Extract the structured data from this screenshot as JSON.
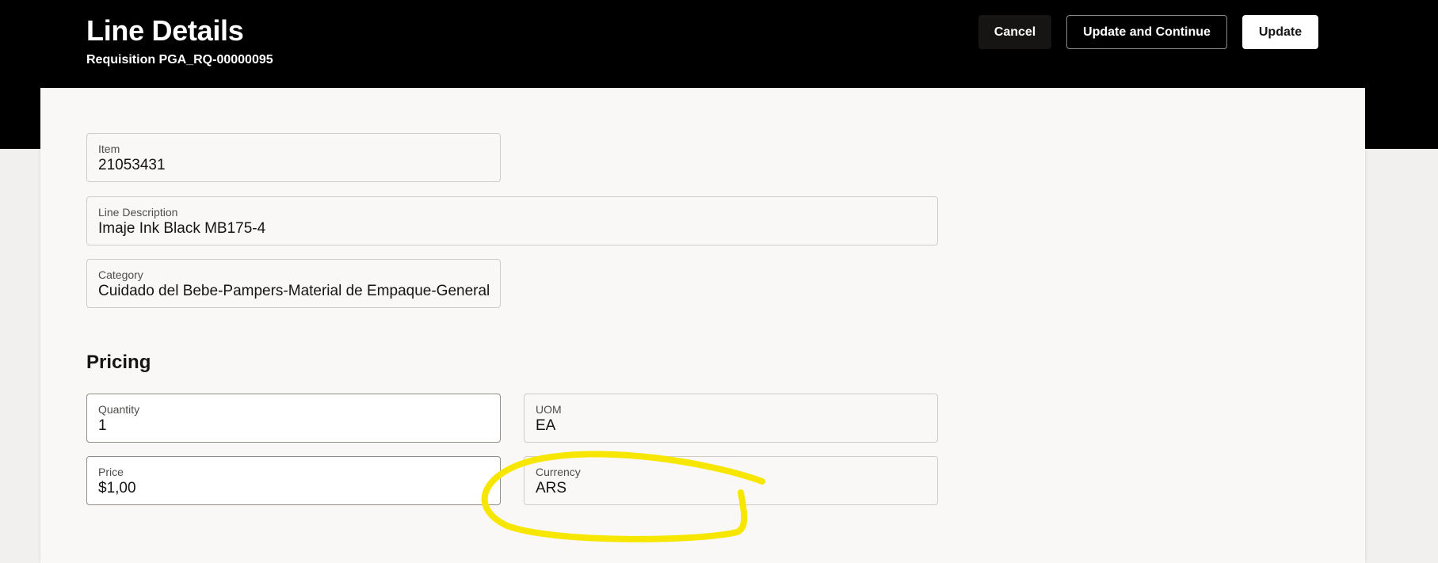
{
  "header": {
    "title": "Line Details",
    "subtitle": "Requisition PGA_RQ-00000095",
    "cancel_label": "Cancel",
    "update_continue_label": "Update and Continue",
    "update_label": "Update"
  },
  "fields": {
    "item": {
      "label": "Item",
      "value": "21053431"
    },
    "line_description": {
      "label": "Line Description",
      "value": "Imaje Ink Black MB175-4"
    },
    "category": {
      "label": "Category",
      "value": "Cuidado del Bebe-Pampers-Material de Empaque-General"
    }
  },
  "pricing": {
    "title": "Pricing",
    "quantity": {
      "label": "Quantity",
      "value": "1"
    },
    "uom": {
      "label": "UOM",
      "value": "EA"
    },
    "price": {
      "label": "Price",
      "value": "$1,00"
    },
    "currency": {
      "label": "Currency",
      "value": "ARS"
    }
  },
  "colors": {
    "header_bg": "#000000",
    "panel_bg": "#f9f8f6",
    "annotation_highlight": "#f7e600"
  }
}
